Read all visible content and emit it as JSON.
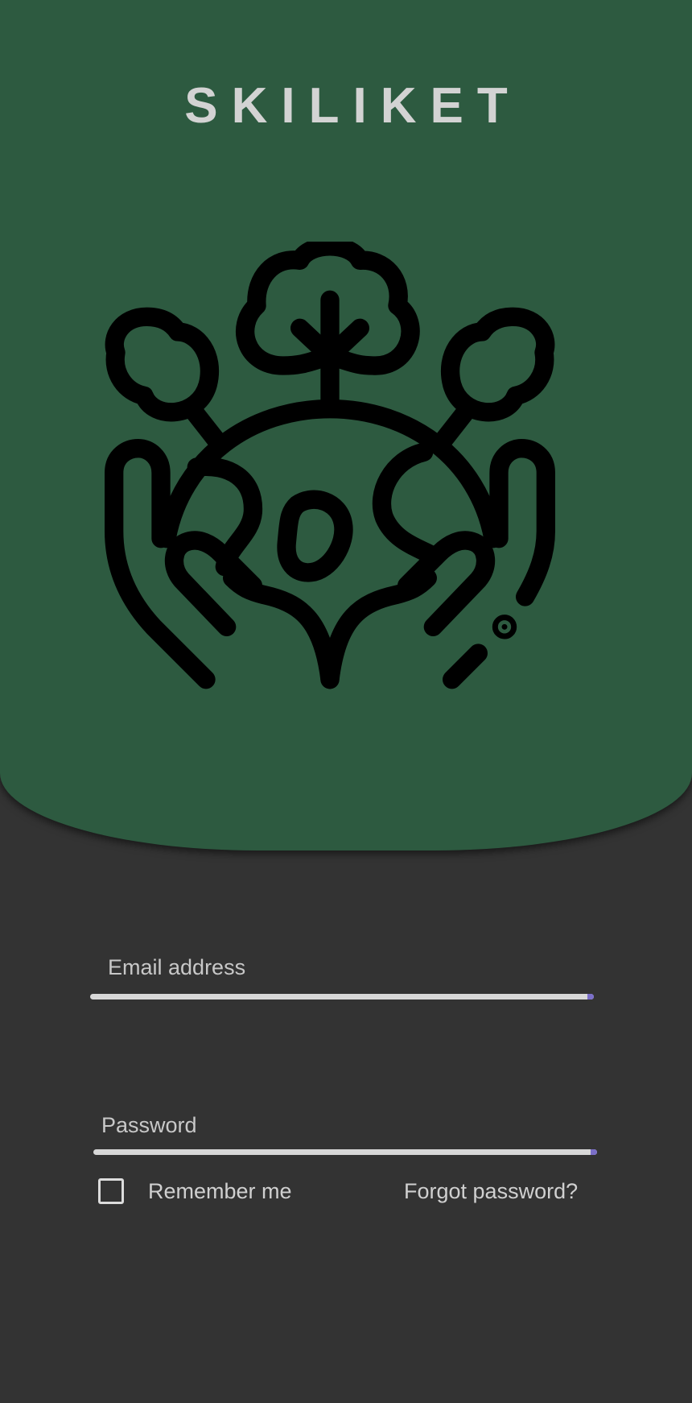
{
  "app": {
    "title": "SKILIKET",
    "logo_icon": "hands-holding-globe-with-trees-icon"
  },
  "login_form": {
    "email": {
      "placeholder": "Email address",
      "value": ""
    },
    "password": {
      "placeholder": "Password",
      "value": ""
    },
    "remember_me": {
      "label": "Remember me",
      "checked": false
    },
    "forgot_password_label": "Forgot password?"
  },
  "colors": {
    "header_green": "#2d5a40",
    "background": "#333333",
    "text_light": "#d3d3d3",
    "underline": "#d8d8d8",
    "underline_accent": "#7b6fc9",
    "logo_stroke": "#000000"
  }
}
